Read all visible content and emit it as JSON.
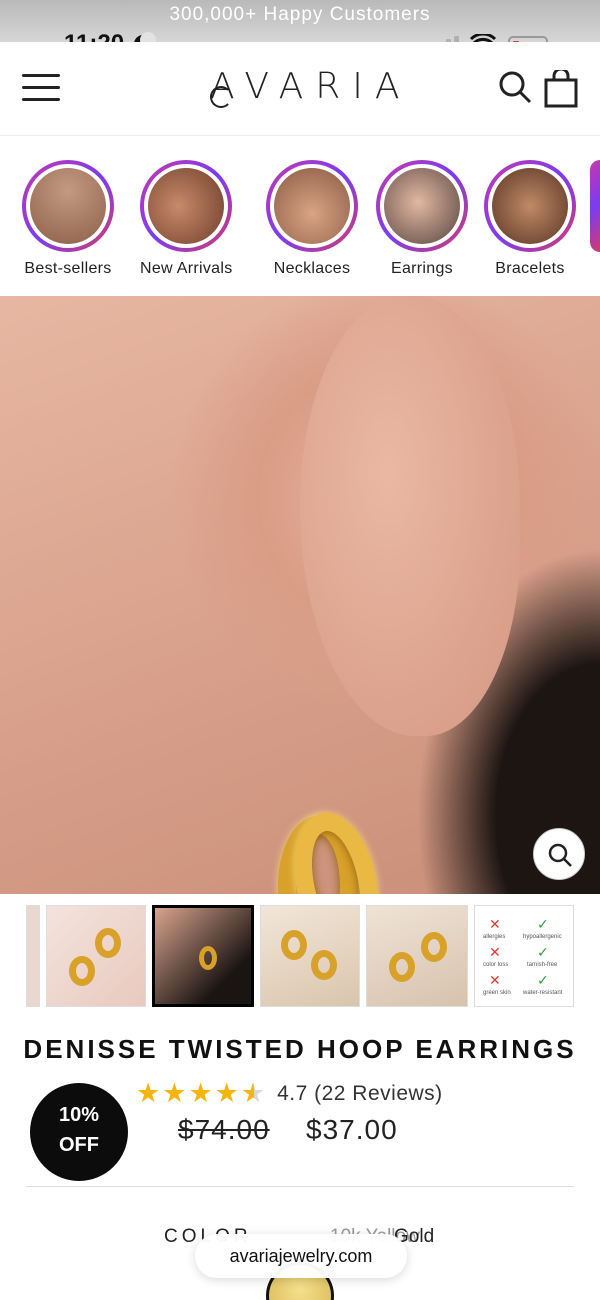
{
  "announcement": "300,000+ Happy Customers",
  "status_bar": {
    "time": "11:20"
  },
  "header": {
    "logo": "AVARIA"
  },
  "categories": [
    {
      "label": "Best-sellers"
    },
    {
      "label": "New Arrivals"
    },
    {
      "label": "Necklaces"
    },
    {
      "label": "Earrings"
    },
    {
      "label": "Bracelets"
    }
  ],
  "thumb_features": {
    "allergies": "allergies",
    "hypoallergenic": "hypoallergenic",
    "color_loss": "color loss",
    "tarnish_free": "tarnish-free",
    "green_skin": "green skin",
    "water_resistant": "water-resistant"
  },
  "product": {
    "title": "DENISSE TWISTED HOOP EARRINGS",
    "rating": 4.7,
    "rating_text": "4.7 (22 Reviews)",
    "price_old": "$74.00",
    "price_new": "$37.00",
    "discount_badge_line1": "10%",
    "discount_badge_line2": "OFF",
    "color_label": "COLOR",
    "color_value_partial": "10k Yellow",
    "color_value_end": "Gold"
  },
  "browser": {
    "url": "avariajewelry.com"
  },
  "colors": {
    "star": "#f5b50a",
    "badge": "#0c0c0c",
    "gold": "#d8a12a"
  }
}
